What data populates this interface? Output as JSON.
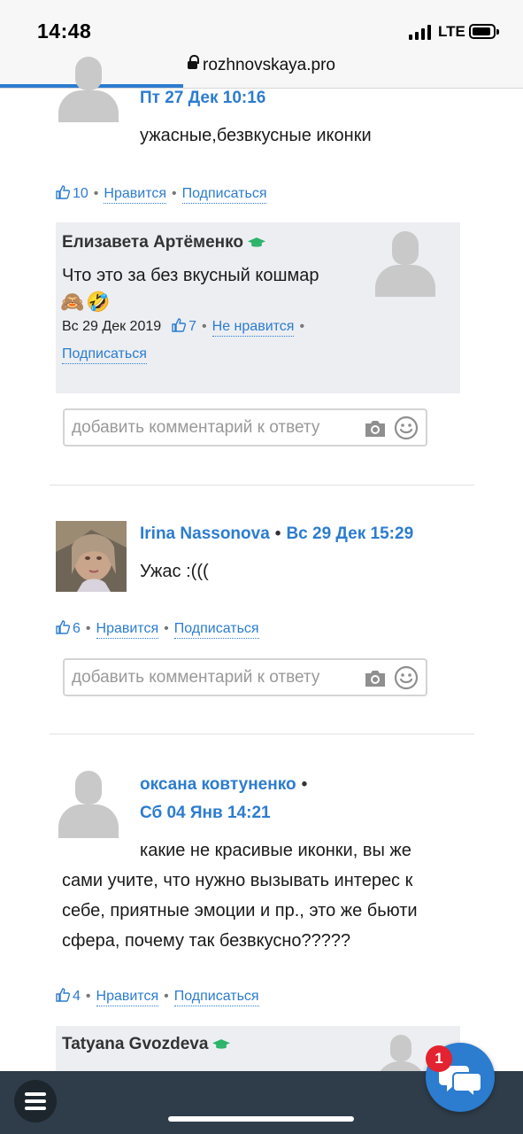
{
  "statusbar": {
    "time": "14:48",
    "network": "LTE",
    "url": "rozhnovskaya.pro",
    "load_progress": 0.35
  },
  "comments": [
    {
      "author": "",
      "date": "Пт 27 Дек 10:16",
      "text": "ужасные,безвкусные иконки",
      "likes": "10",
      "action": "Нравится",
      "subscribe": "Подписаться",
      "replies": [
        {
          "author": "Елизавета Артёменко",
          "text": "Что это за без вкусный кошмар",
          "emoji": "🙈🤣",
          "date": "Вс 29 Дек 2019",
          "likes": "7",
          "action": "Не нравится",
          "subscribe": "Подписаться"
        }
      ],
      "reply_placeholder": "добавить комментарий к ответу"
    },
    {
      "author": "Irina Nassonova",
      "date": "Вс 29 Дек 15:29",
      "text": "Ужас :(((",
      "likes": "6",
      "action": "Нравится",
      "subscribe": "Подписаться",
      "reply_placeholder": "добавить комментарий к ответу"
    },
    {
      "author": "оксана ковтуненко",
      "date": "Сб 04 Янв 14:21",
      "text_lines": [
        "какие не красивые иконки, вы же",
        "сами учите, что нужно вызывать интерес к",
        "себе, приятные эмоции и пр., это же бьюти",
        "сфера, почему так безвкусно?????"
      ],
      "likes": "4",
      "action": "Нравится",
      "subscribe": "Подписаться",
      "replies": [
        {
          "author": "Tatyana Gvozdeva"
        }
      ]
    }
  ],
  "chat": {
    "badge": "1"
  },
  "colors": {
    "link": "#2c7ccf",
    "reply_bg": "#eceef2",
    "bottom_bar": "#2f3d4a",
    "badge": "#e32330",
    "graduate_icon": "#2db36a"
  }
}
